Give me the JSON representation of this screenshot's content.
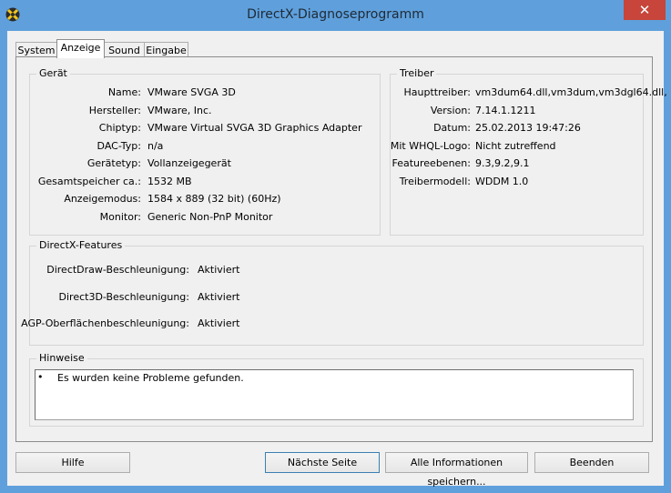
{
  "window": {
    "title": "DirectX-Diagnoseprogramm",
    "close_symbol": "✕"
  },
  "tabs": [
    "System",
    "Anzeige",
    "Sound",
    "Eingabe"
  ],
  "device_group": {
    "title": "Gerät",
    "rows": [
      {
        "label": "Name:",
        "value": "VMware SVGA 3D"
      },
      {
        "label": "Hersteller:",
        "value": "VMware, Inc."
      },
      {
        "label": "Chiptyp:",
        "value": "VMware Virtual SVGA 3D Graphics Adapter"
      },
      {
        "label": "DAC-Typ:",
        "value": "n/a"
      },
      {
        "label": "Gerätetyp:",
        "value": "Vollanzeigegerät"
      },
      {
        "label": "Gesamtspeicher ca.:",
        "value": "1532 MB"
      },
      {
        "label": "Anzeigemodus:",
        "value": "1584 x 889 (32 bit) (60Hz)"
      },
      {
        "label": "Monitor:",
        "value": "Generic Non-PnP Monitor"
      }
    ]
  },
  "driver_group": {
    "title": "Treiber",
    "rows": [
      {
        "label": "Haupttreiber:",
        "value": "vm3dum64.dll,vm3dum,vm3dgl64.dll,"
      },
      {
        "label": "Version:",
        "value": "7.14.1.1211"
      },
      {
        "label": "Datum:",
        "value": "25.02.2013 19:47:26"
      },
      {
        "label": "Mit WHQL-Logo:",
        "value": "Nicht zutreffend"
      },
      {
        "label": "Featureebenen:",
        "value": "9.3,9.2,9.1"
      },
      {
        "label": "Treibermodell:",
        "value": "WDDM 1.0"
      }
    ]
  },
  "features_group": {
    "title": "DirectX-Features",
    "rows": [
      {
        "label": "DirectDraw-Beschleunigung:",
        "value": "Aktiviert"
      },
      {
        "label": "Direct3D-Beschleunigung:",
        "value": "Aktiviert"
      },
      {
        "label": "AGP-Oberflächenbeschleunigung:",
        "value": "Aktiviert"
      }
    ]
  },
  "notes_group": {
    "title": "Hinweise",
    "bullet": "•",
    "text": "Es wurden keine Probleme gefunden."
  },
  "buttons": {
    "help": "Hilfe",
    "next_page": "Nächste Seite",
    "save_all": "Alle Informationen speichern...",
    "exit": "Beenden"
  }
}
